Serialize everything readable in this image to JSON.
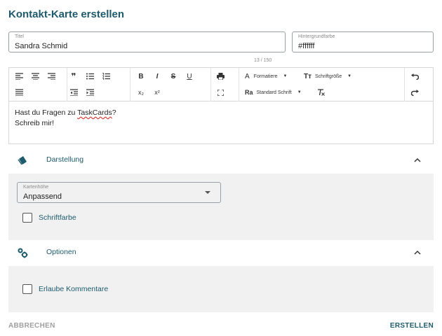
{
  "dialog": {
    "title": "Kontakt-Karte erstellen"
  },
  "fields": {
    "title": {
      "label": "Titel",
      "value": "Sandra Schmid"
    },
    "background": {
      "label": "Hintergrundfarbe",
      "value": "#ffffff"
    },
    "counter": "13 / 150"
  },
  "toolbar": {
    "format_label": "Formatiere",
    "fontsize_label": "Schriftgröße",
    "fontfamily_label": "Standard Schrift",
    "bold": "B",
    "italic": "I",
    "strike": "S",
    "underline": "U",
    "subscript": "x₂",
    "superscript": "x²"
  },
  "editor": {
    "line1_prefix": "Hast du Fragen zu ",
    "line1_word": "TaskCards",
    "line1_suffix": "?",
    "line2": "Schreib mir!"
  },
  "sections": {
    "appearance": {
      "label": "Darstellung",
      "height_select": {
        "label": "Kartenhöhe",
        "value": "Anpassend"
      },
      "font_color_label": "Schriftfarbe"
    },
    "options": {
      "label": "Optionen",
      "allow_comments_label": "Erlaube Kommentare"
    }
  },
  "actions": {
    "cancel": "ABBRECHEN",
    "create": "ERSTELLEN"
  },
  "colors": {
    "accent": "#1d5a6c",
    "panel": "#f1f1f1",
    "muted": "#9e9e9e"
  }
}
